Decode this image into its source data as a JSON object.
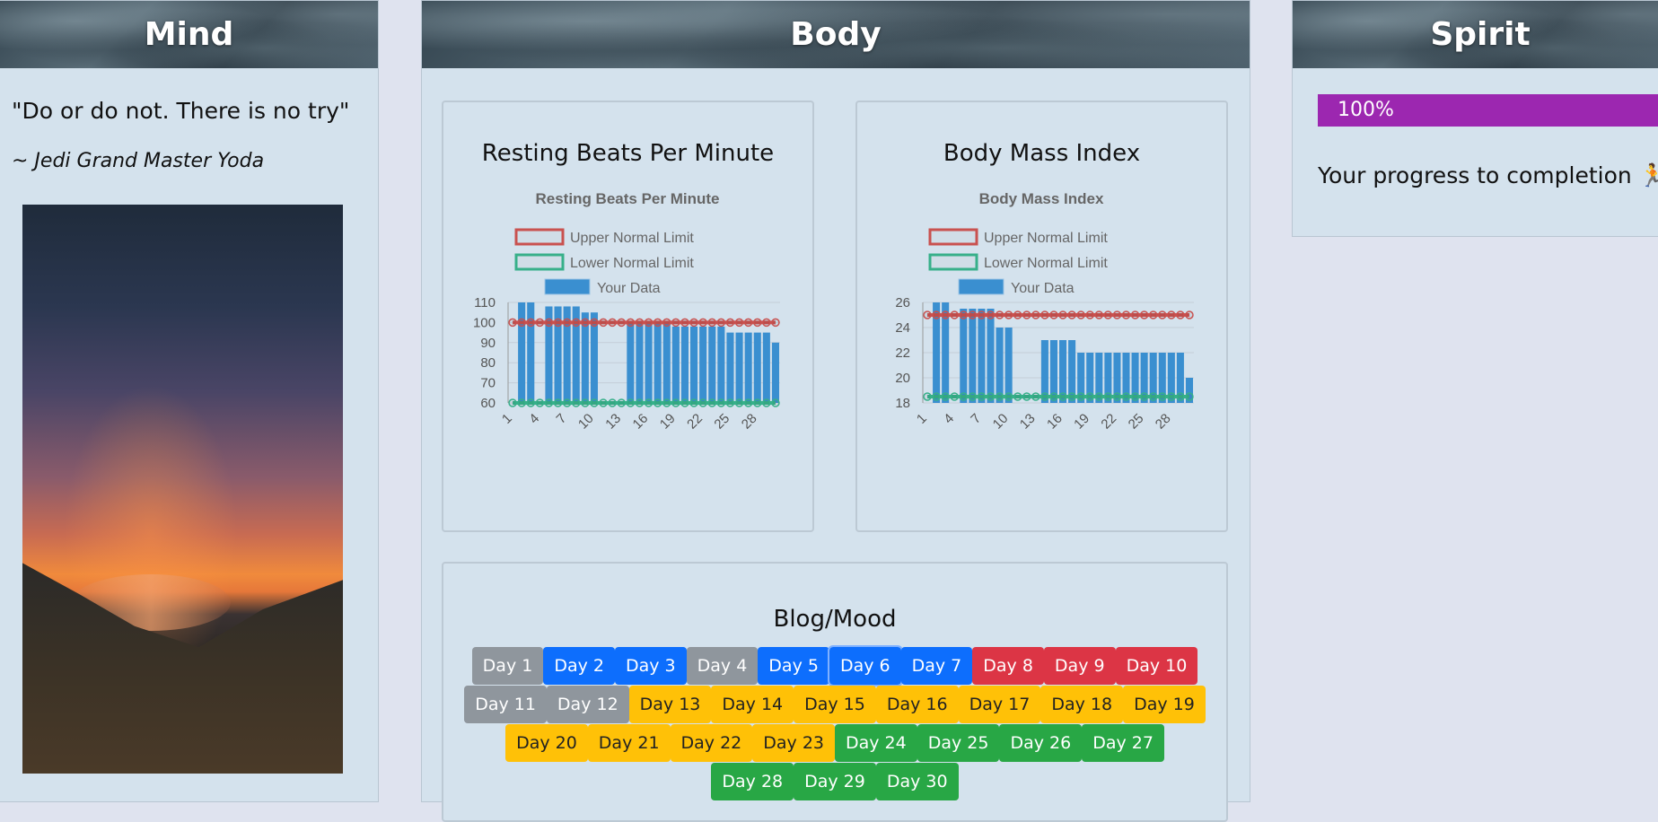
{
  "mind": {
    "title": "Mind",
    "quote": "\"Do or do not. There is no try\"",
    "author": "~ Jedi Grand Master Yoda"
  },
  "body": {
    "title": "Body",
    "bpm_card_title": "Resting Beats Per Minute",
    "bmi_card_title": "Body Mass Index",
    "blog_title": "Blog/Mood",
    "days": [
      {
        "label": "Day 1",
        "mood": "gray"
      },
      {
        "label": "Day 2",
        "mood": "blue"
      },
      {
        "label": "Day 3",
        "mood": "blue"
      },
      {
        "label": "Day 4",
        "mood": "gray"
      },
      {
        "label": "Day 5",
        "mood": "blue"
      },
      {
        "label": "Day 6",
        "mood": "blue"
      },
      {
        "label": "Day 7",
        "mood": "blue"
      },
      {
        "label": "Day 8",
        "mood": "red"
      },
      {
        "label": "Day 9",
        "mood": "red"
      },
      {
        "label": "Day 10",
        "mood": "red"
      },
      {
        "label": "Day 11",
        "mood": "gray"
      },
      {
        "label": "Day 12",
        "mood": "gray"
      },
      {
        "label": "Day 13",
        "mood": "yellow"
      },
      {
        "label": "Day 14",
        "mood": "yellow"
      },
      {
        "label": "Day 15",
        "mood": "yellow"
      },
      {
        "label": "Day 16",
        "mood": "yellow"
      },
      {
        "label": "Day 17",
        "mood": "yellow"
      },
      {
        "label": "Day 18",
        "mood": "yellow"
      },
      {
        "label": "Day 19",
        "mood": "yellow"
      },
      {
        "label": "Day 20",
        "mood": "yellow"
      },
      {
        "label": "Day 21",
        "mood": "yellow"
      },
      {
        "label": "Day 22",
        "mood": "yellow"
      },
      {
        "label": "Day 23",
        "mood": "yellow"
      },
      {
        "label": "Day 24",
        "mood": "green"
      },
      {
        "label": "Day 25",
        "mood": "green"
      },
      {
        "label": "Day 26",
        "mood": "green"
      },
      {
        "label": "Day 27",
        "mood": "green"
      },
      {
        "label": "Day 28",
        "mood": "green"
      },
      {
        "label": "Day 29",
        "mood": "green"
      },
      {
        "label": "Day 30",
        "mood": "green"
      }
    ],
    "selected_day": "Day 6"
  },
  "spirit": {
    "title": "Spirit",
    "progress_label": "100%",
    "progress_value": 1.0,
    "progress_text": "Your progress to completion",
    "progress_icon": "running-person-icon",
    "progress_color": "#9c27b0"
  },
  "chart_data": [
    {
      "type": "bar",
      "title": "Resting Beats Per Minute",
      "legend": [
        "Upper Normal Limit",
        "Lower Normal Limit",
        "Your Data"
      ],
      "legend_position": "top",
      "x": [
        1,
        2,
        3,
        4,
        5,
        6,
        7,
        8,
        9,
        10,
        11,
        12,
        13,
        14,
        15,
        16,
        17,
        18,
        19,
        20,
        21,
        22,
        23,
        24,
        25,
        26,
        27,
        28,
        29,
        30
      ],
      "x_tick_labels": [
        "1",
        "4",
        "7",
        "10",
        "13",
        "16",
        "19",
        "22",
        "25",
        "28"
      ],
      "ylim": [
        60,
        110
      ],
      "y_ticks": [
        60,
        70,
        80,
        90,
        100,
        110
      ],
      "series": [
        {
          "name": "Your Data",
          "color": "#3a8fd0",
          "values": [
            0,
            110,
            110,
            0,
            108,
            108,
            108,
            108,
            105,
            105,
            0,
            0,
            0,
            100,
            100,
            100,
            100,
            100,
            98,
            98,
            98,
            98,
            98,
            98,
            95,
            95,
            95,
            95,
            95,
            90
          ]
        },
        {
          "name": "Upper Normal Limit",
          "color": "#c9514f",
          "values": [
            100,
            100,
            100,
            100,
            100,
            100,
            100,
            100,
            100,
            100,
            100,
            100,
            100,
            100,
            100,
            100,
            100,
            100,
            100,
            100,
            100,
            100,
            100,
            100,
            100,
            100,
            100,
            100,
            100,
            100
          ]
        },
        {
          "name": "Lower Normal Limit",
          "color": "#37b08a",
          "values": [
            60,
            60,
            60,
            60,
            60,
            60,
            60,
            60,
            60,
            60,
            60,
            60,
            60,
            60,
            60,
            60,
            60,
            60,
            60,
            60,
            60,
            60,
            60,
            60,
            60,
            60,
            60,
            60,
            60,
            60
          ]
        }
      ]
    },
    {
      "type": "bar",
      "title": "Body Mass Index",
      "legend": [
        "Upper Normal Limit",
        "Lower Normal Limit",
        "Your Data"
      ],
      "legend_position": "top",
      "x": [
        1,
        2,
        3,
        4,
        5,
        6,
        7,
        8,
        9,
        10,
        11,
        12,
        13,
        14,
        15,
        16,
        17,
        18,
        19,
        20,
        21,
        22,
        23,
        24,
        25,
        26,
        27,
        28,
        29,
        30
      ],
      "x_tick_labels": [
        "1",
        "4",
        "7",
        "10",
        "13",
        "16",
        "19",
        "22",
        "25",
        "28"
      ],
      "ylim": [
        18,
        26
      ],
      "y_ticks": [
        18,
        20,
        22,
        24,
        26
      ],
      "series": [
        {
          "name": "Your Data",
          "color": "#3a8fd0",
          "values": [
            0,
            26,
            26,
            0,
            25.5,
            25.5,
            25.5,
            25.5,
            24,
            24,
            0,
            0,
            0,
            23,
            23,
            23,
            23,
            22,
            22,
            22,
            22,
            22,
            22,
            22,
            22,
            22,
            22,
            22,
            22,
            20
          ]
        },
        {
          "name": "Upper Normal Limit",
          "color": "#c9514f",
          "values": [
            25,
            25,
            25,
            25,
            25,
            25,
            25,
            25,
            25,
            25,
            25,
            25,
            25,
            25,
            25,
            25,
            25,
            25,
            25,
            25,
            25,
            25,
            25,
            25,
            25,
            25,
            25,
            25,
            25,
            25
          ]
        },
        {
          "name": "Lower Normal Limit",
          "color": "#37b08a",
          "values": [
            18.5,
            18.5,
            18.5,
            18.5,
            18.5,
            18.5,
            18.5,
            18.5,
            18.5,
            18.5,
            18.5,
            18.5,
            18.5,
            18.5,
            18.5,
            18.5,
            18.5,
            18.5,
            18.5,
            18.5,
            18.5,
            18.5,
            18.5,
            18.5,
            18.5,
            18.5,
            18.5,
            18.5,
            18.5,
            18.5
          ]
        }
      ]
    }
  ]
}
